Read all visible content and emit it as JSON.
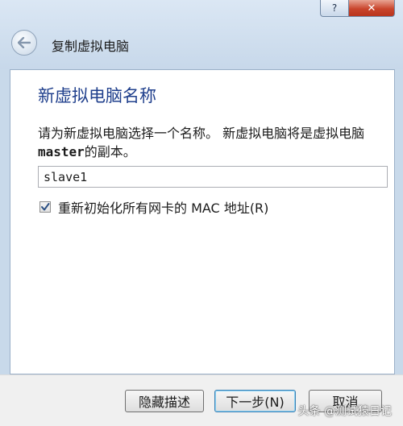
{
  "window": {
    "title": "复制虚拟电脑",
    "help_label": "?",
    "close_label": "✕"
  },
  "page": {
    "heading": "新虚拟电脑名称",
    "description_part1": "请为新虚拟电脑选择一个名称。 新虚拟电脑将是虚拟电脑 ",
    "vm_name": "master",
    "description_part2": "的副本。",
    "name_input_value": "slave1",
    "reinit_mac": {
      "label": "重新初始化所有网卡的 MAC 地址(R)",
      "checked": true
    }
  },
  "footer": {
    "hide_description_label": "隐藏描述",
    "next_label": "下一步(N)",
    "cancel_label": "取消"
  },
  "watermark": "头条 @测试猿日记"
}
